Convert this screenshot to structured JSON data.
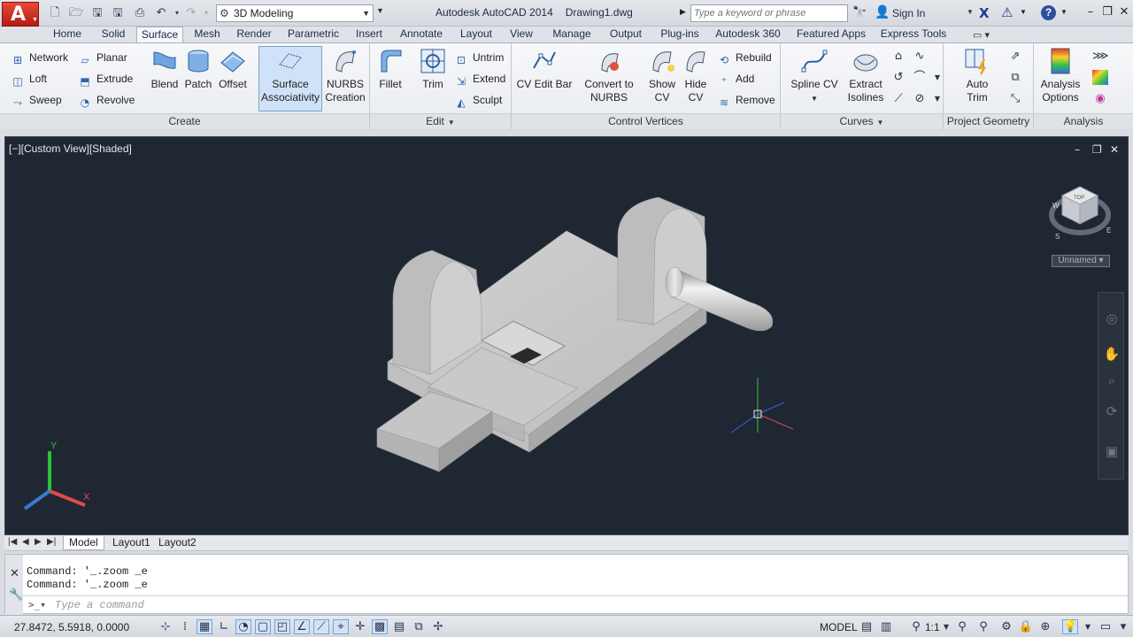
{
  "titlebar": {
    "workspace": "3D Modeling",
    "app_name": "Autodesk AutoCAD 2014",
    "file_name": "Drawing1.dwg",
    "search_placeholder": "Type a keyword or phrase",
    "sign_in": "Sign In"
  },
  "ribbon": {
    "tabs": [
      "Home",
      "Solid",
      "Surface",
      "Mesh",
      "Render",
      "Parametric",
      "Insert",
      "Annotate",
      "Layout",
      "View",
      "Manage",
      "Output",
      "Plug-ins",
      "Autodesk 360",
      "Featured Apps",
      "Express Tools"
    ],
    "active_tab": "Surface",
    "panels": {
      "create": {
        "label": "Create",
        "small": [
          "Network",
          "Loft",
          "Sweep",
          "Planar",
          "Extrude",
          "Revolve"
        ],
        "large": [
          "Blend",
          "Patch",
          "Offset"
        ],
        "surface_assoc": [
          "Surface",
          "Associativity"
        ],
        "nurbs_creation": [
          "NURBS",
          "Creation"
        ]
      },
      "edit": {
        "label": "Edit",
        "fillet": "Fillet",
        "trim": "Trim",
        "small": [
          "Untrim",
          "Extend",
          "Sculpt"
        ]
      },
      "control_vertices": {
        "label": "Control Vertices",
        "cv_edit_bar": "CV Edit Bar",
        "convert": [
          "Convert to",
          "NURBS"
        ],
        "show_cv": [
          "Show",
          "CV"
        ],
        "hide_cv": [
          "Hide",
          "CV"
        ],
        "small": [
          "Rebuild",
          "Add",
          "Remove"
        ]
      },
      "curves": {
        "label": "Curves",
        "spline_cv": "Spline CV",
        "extract": [
          "Extract",
          "Isolines"
        ]
      },
      "project_geometry": {
        "label": "Project Geometry",
        "auto_trim": [
          "Auto",
          "Trim"
        ]
      },
      "analysis": {
        "label": "Analysis",
        "options": [
          "Analysis",
          "Options"
        ]
      }
    }
  },
  "viewport": {
    "label": "[−][Custom View][Shaded]",
    "viewcube_face": "TOP",
    "viewcube_compass": [
      "W",
      "S",
      "E"
    ],
    "ucs_name": "Unnamed",
    "axis_labels": [
      "Y",
      "X"
    ]
  },
  "layout_tabs": [
    "Model",
    "Layout1",
    "Layout2"
  ],
  "command": {
    "history": [
      "Command:  '_.zoom _e",
      "Command:  '_.zoom _e"
    ],
    "placeholder": "Type a command"
  },
  "status": {
    "coords": "27.8472, 5.5918, 0.0000",
    "model": "MODEL",
    "scale": "1:1"
  }
}
